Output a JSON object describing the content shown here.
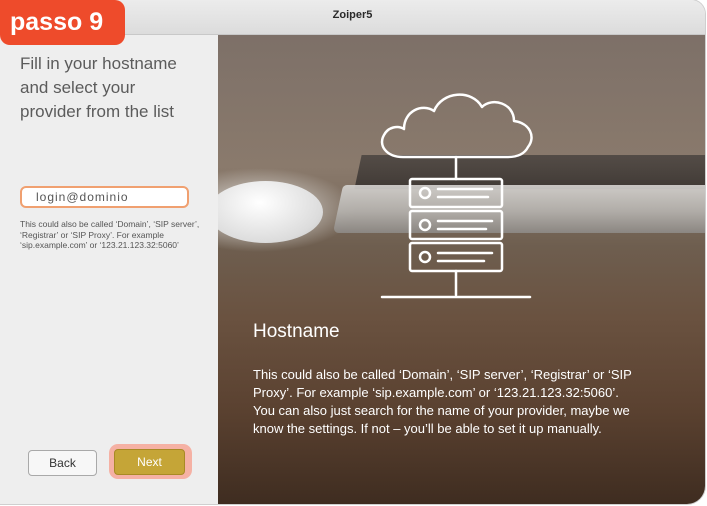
{
  "step_badge": "passo 9",
  "window": {
    "title": "Zoiper5"
  },
  "left_panel": {
    "heading": "Fill in your hostname and select your provider from the list",
    "host_input": {
      "value": "login@dominio",
      "placeholder": ""
    },
    "hint": "This could also be called ‘Domain’, ‘SIP server’, ‘Registrar’ or ‘SIP Proxy’. For example ‘sip.example.com’ or ‘123.21.123.32:5060’",
    "back_label": "Back",
    "next_label": "Next"
  },
  "info_panel": {
    "title": "Hostname",
    "paragraph1": " This could also be called ‘Domain’, ‘SIP server’, ‘Registrar’ or ‘SIP Proxy’. For example ‘sip.example.com’ or ‘123.21.123.32:5060’.",
    "paragraph2": "You can also just search for the name of your provider, maybe we know the settings. If not – you’ll be able to set it up manually."
  },
  "colors": {
    "badge": "#ee4b2b",
    "next_button": "#c5a537",
    "input_border": "#f0a070"
  },
  "icons": [
    "cloud-server-illustration-icon"
  ]
}
